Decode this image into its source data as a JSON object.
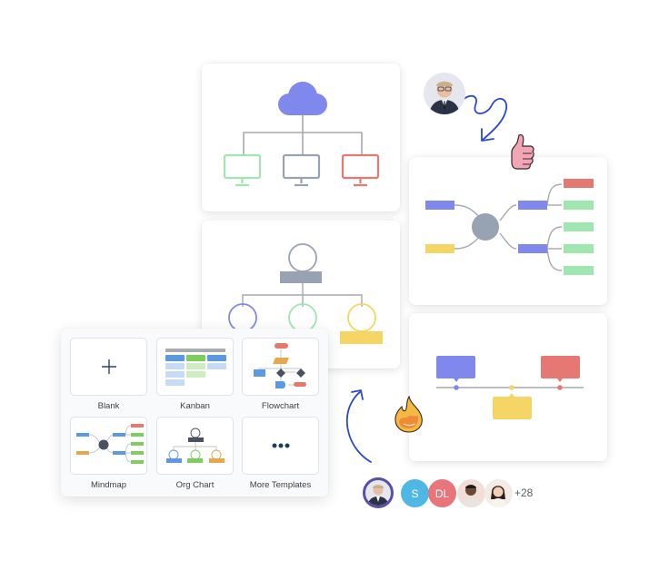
{
  "colors": {
    "purple": "#8088ee",
    "green": "#9fe6b0",
    "gray": "#97a2b3",
    "red": "#e57872",
    "yellow": "#f5d565",
    "line": "#a6a9ad",
    "blue_tpl": "#5b9ae2",
    "green_tpl": "#7ccf5c",
    "orange_tpl": "#e6a84a",
    "dark_tpl": "#4a5160",
    "pen": "#2c48d0"
  },
  "canvas_cards": [
    {
      "name": "network-diagram",
      "description": "Cloud connected to three monitors"
    },
    {
      "name": "org-chart-diagram",
      "description": "Org chart with top node and three children"
    },
    {
      "name": "mindmap-diagram",
      "description": "Mind map with central node and branches"
    },
    {
      "name": "timeline-diagram",
      "description": "Timeline with three callout boxes"
    }
  ],
  "templates": {
    "items": [
      {
        "label": "Blank",
        "icon": "plus-icon"
      },
      {
        "label": "Kanban",
        "icon": "kanban-thumbnail"
      },
      {
        "label": "Flowchart",
        "icon": "flowchart-thumbnail"
      },
      {
        "label": "Mindmap",
        "icon": "mindmap-thumbnail"
      },
      {
        "label": "Org Chart",
        "icon": "org-chart-thumbnail"
      },
      {
        "label": "More Templates",
        "icon": "ellipsis-icon"
      }
    ]
  },
  "collaborators": {
    "initials": [
      "S",
      "DL"
    ],
    "initial_colors": [
      "#4fb7e3",
      "#e8757a"
    ],
    "more_count": "+28"
  },
  "reactions": [
    "thumbs-up",
    "fire"
  ]
}
